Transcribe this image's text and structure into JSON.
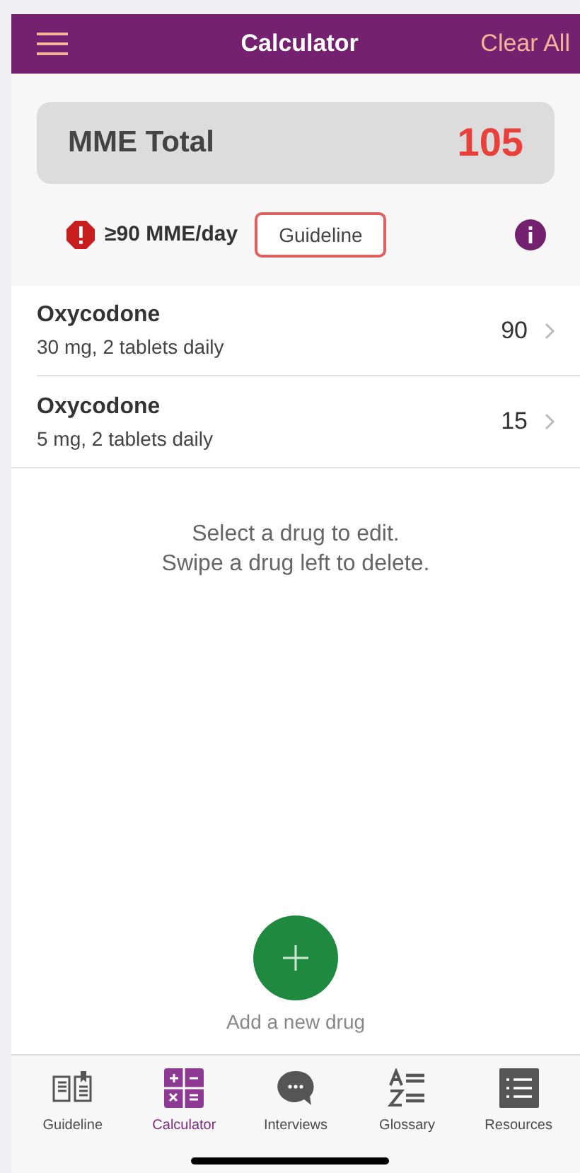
{
  "header": {
    "title": "Calculator",
    "action": "Clear All"
  },
  "total": {
    "label": "MME Total",
    "value": "105"
  },
  "alert": {
    "text": "≥90 MME/day",
    "button": "Guideline"
  },
  "drugs": [
    {
      "name": "Oxycodone",
      "dose": "30 mg, 2 tablets daily",
      "mme": "90"
    },
    {
      "name": "Oxycodone",
      "dose": "5 mg, 2 tablets daily",
      "mme": "15"
    }
  ],
  "hint": [
    "Select a drug to edit.",
    "Swipe a drug left to delete."
  ],
  "add_label": "Add a new drug",
  "tabs": [
    {
      "kind": "book",
      "label": "Guideline",
      "selected": false
    },
    {
      "kind": "calculator",
      "label": "Calculator",
      "selected": true
    },
    {
      "kind": "chat",
      "label": "Interviews",
      "selected": false
    },
    {
      "kind": "az",
      "label": "Glossary",
      "selected": false
    },
    {
      "kind": "list",
      "label": "Resources",
      "selected": false
    }
  ]
}
